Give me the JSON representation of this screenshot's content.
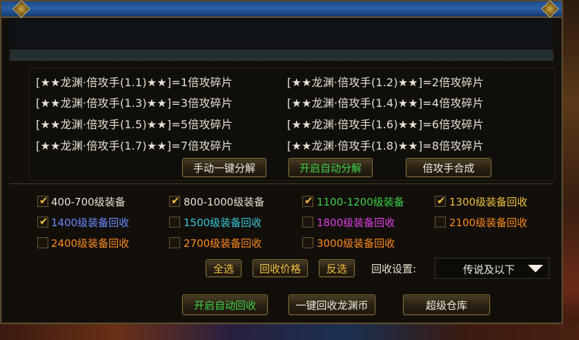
{
  "fragments": [
    "[★★龙渊·倍攻手(1.1)★★]=1倍攻碎片",
    "[★★龙渊·倍攻手(1.2)★★]=2倍攻碎片",
    "[★★龙渊·倍攻手(1.3)★★]=3倍攻碎片",
    "[★★龙渊·倍攻手(1.4)★★]=4倍攻碎片",
    "[★★龙渊·倍攻手(1.5)★★]=5倍攻碎片",
    "[★★龙渊·倍攻手(1.6)★★]=6倍攻碎片",
    "[★★龙渊·倍攻手(1.7)★★]=7倍攻碎片",
    "[★★龙渊·倍攻手(1.8)★★]=8倍攻碎片"
  ],
  "fragment_buttons": {
    "manual_decompose": "手动一键分解",
    "auto_decompose": "开启自动分解",
    "synthesize": "倍攻手合成"
  },
  "recycle_options": [
    {
      "label": "400-700级装备",
      "checked": true,
      "color": "#e8e2d2"
    },
    {
      "label": "800-1000级装备",
      "checked": true,
      "color": "#e8e2d2"
    },
    {
      "label": "1100-1200级装备",
      "checked": true,
      "color": "#3ed24a"
    },
    {
      "label": "1300级装备回收",
      "checked": true,
      "color": "#f2c040"
    },
    {
      "label": "1400级装备回收",
      "checked": true,
      "color": "#6c8cff"
    },
    {
      "label": "1500级装备回收",
      "checked": false,
      "color": "#38c8d8"
    },
    {
      "label": "1800级装备回收",
      "checked": false,
      "color": "#e040e8"
    },
    {
      "label": "2100级装备回收",
      "checked": false,
      "color": "#ff8a1e"
    },
    {
      "label": "2400级装备回收",
      "checked": false,
      "color": "#ff8a1e"
    },
    {
      "label": "2700级装备回收",
      "checked": false,
      "color": "#ff8a1e"
    },
    {
      "label": "3000级装备回收",
      "checked": false,
      "color": "#ff8a1e"
    }
  ],
  "recycle_controls": {
    "select_all": "全选",
    "recycle_price": "回收价格",
    "invert": "反选",
    "setting_label": "回收设置:",
    "setting_value": "传说及以下"
  },
  "bottom_buttons": {
    "auto_recycle": "开启自动回收",
    "one_click_recycle": "一键回收龙渊币",
    "super_warehouse": "超级仓库"
  },
  "colors": {
    "green_text": "#3ed24a",
    "white_text": "#f0ece0",
    "check_color": "#f2c040",
    "frame_gold": "#8a7440"
  }
}
